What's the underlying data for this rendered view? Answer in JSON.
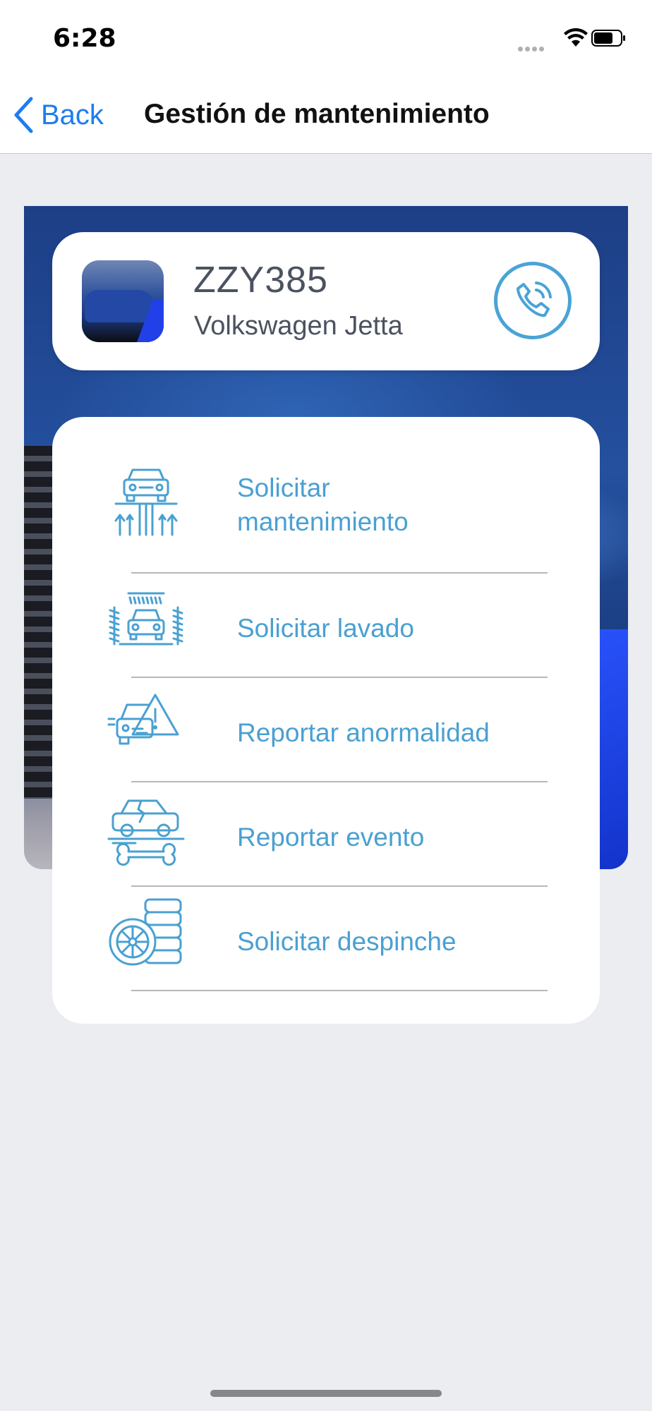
{
  "status_bar": {
    "time": "6:28"
  },
  "nav": {
    "back_label": "Back",
    "title": "Gestión de mantenimiento"
  },
  "vehicle": {
    "plate": "ZZY385",
    "model": "Volkswagen Jetta"
  },
  "menu": {
    "items": [
      {
        "label_line1": "Solicitar",
        "label_line2": "mantenimiento",
        "icon": "car-lift-icon"
      },
      {
        "label": "Solicitar lavado",
        "icon": "car-wash-icon"
      },
      {
        "label": "Reportar anormalidad",
        "icon": "car-warning-icon"
      },
      {
        "label": "Reportar evento",
        "icon": "car-repair-icon"
      },
      {
        "label": "Solicitar despinche",
        "icon": "tire-icon"
      }
    ]
  },
  "colors": {
    "accent": "#4aa0d2",
    "ios_blue": "#1e7cf2",
    "background": "#ebedf1"
  }
}
